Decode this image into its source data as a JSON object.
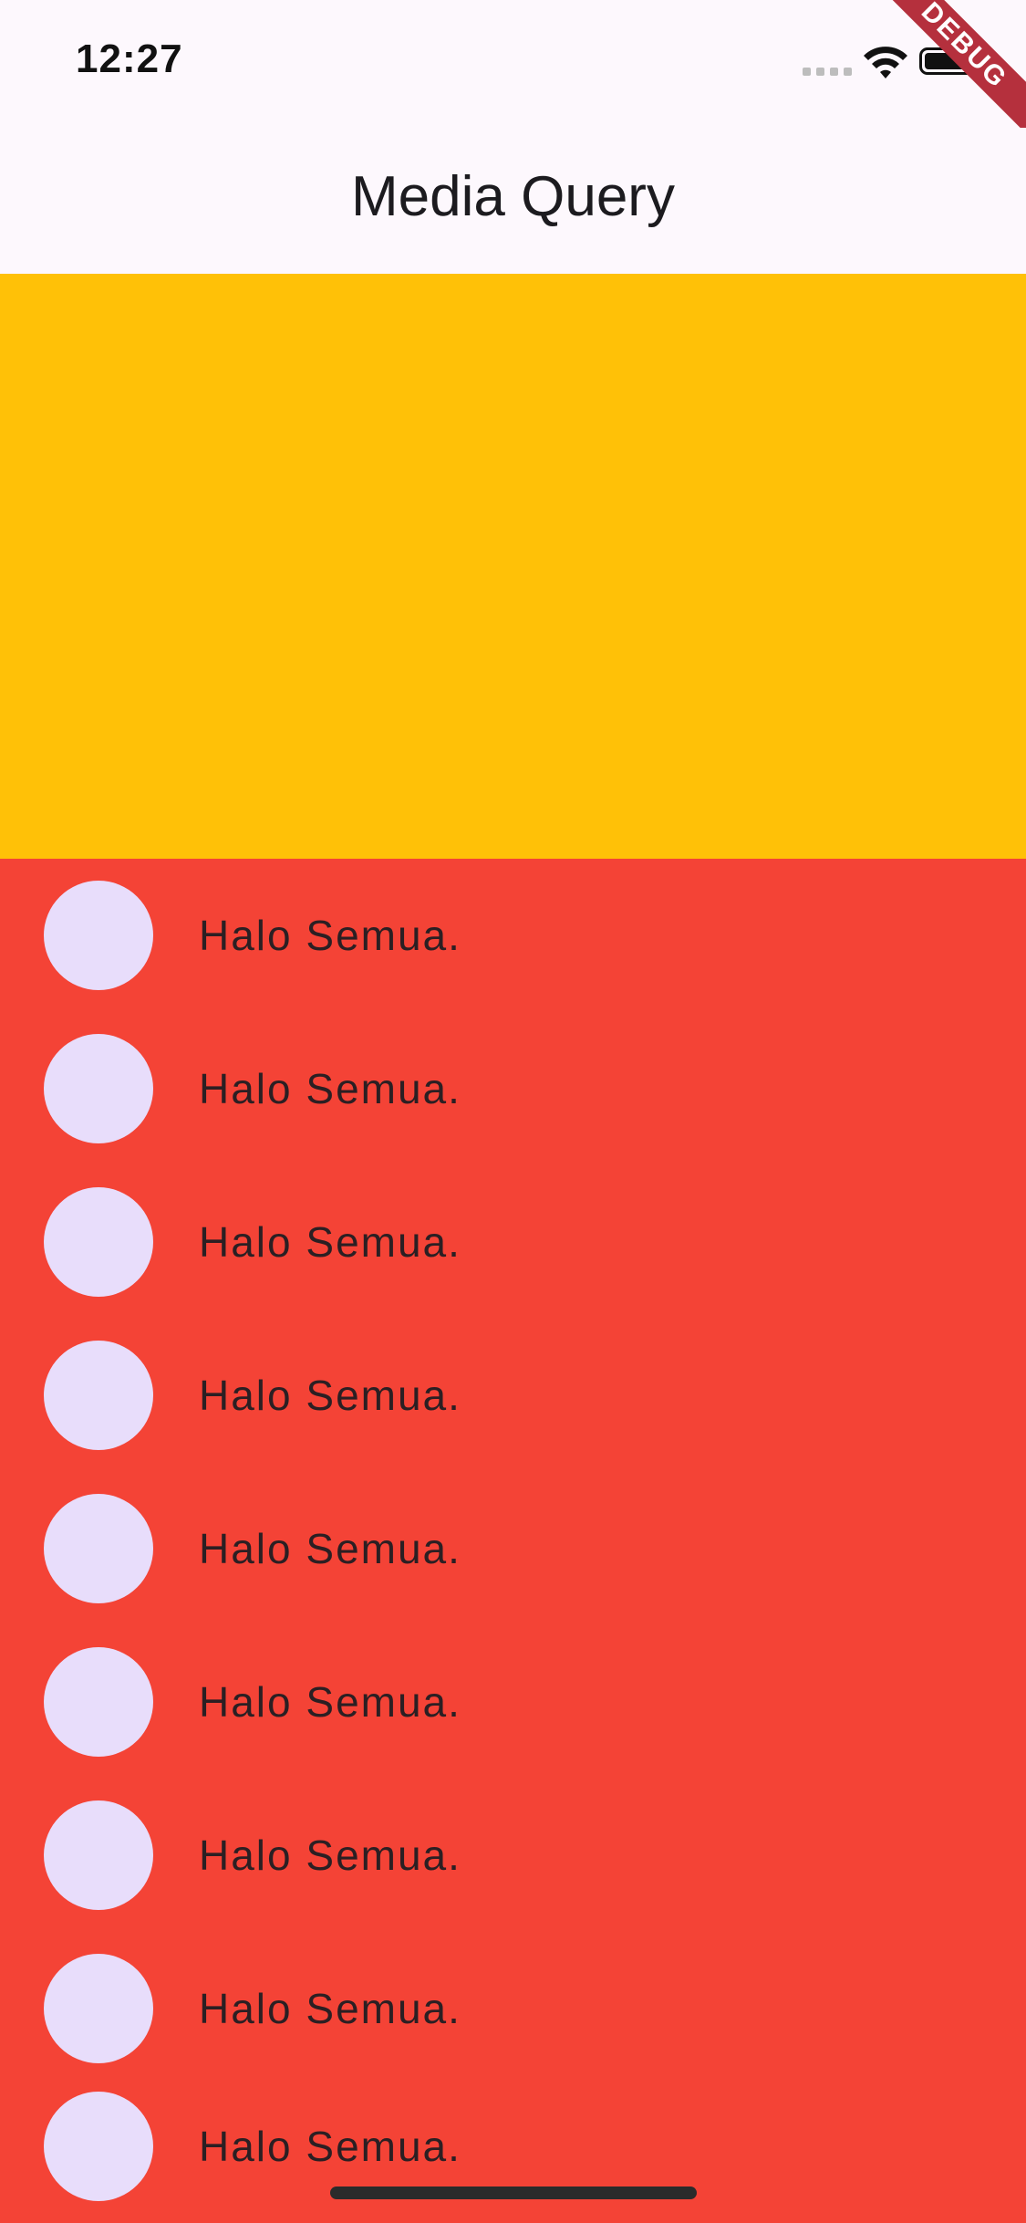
{
  "status_bar": {
    "time": "12:27",
    "icons": [
      "cellular-signal-icon",
      "wifi-icon",
      "battery-icon"
    ]
  },
  "app_bar": {
    "title": "Media Query"
  },
  "debug_banner": {
    "label": "DEBUG"
  },
  "colors": {
    "app_bar_bg": "#fdf8fd",
    "banner": "#ffc107",
    "list_bg": "#f44336",
    "avatar": "#e8ddfb",
    "text": "#2b1f23"
  },
  "list": {
    "items": [
      {
        "label": "Halo Semua."
      },
      {
        "label": "Halo Semua."
      },
      {
        "label": "Halo Semua."
      },
      {
        "label": "Halo Semua."
      },
      {
        "label": "Halo Semua."
      },
      {
        "label": "Halo Semua."
      },
      {
        "label": "Halo Semua."
      },
      {
        "label": "Halo Semua."
      },
      {
        "label": "Halo Semua."
      }
    ]
  }
}
